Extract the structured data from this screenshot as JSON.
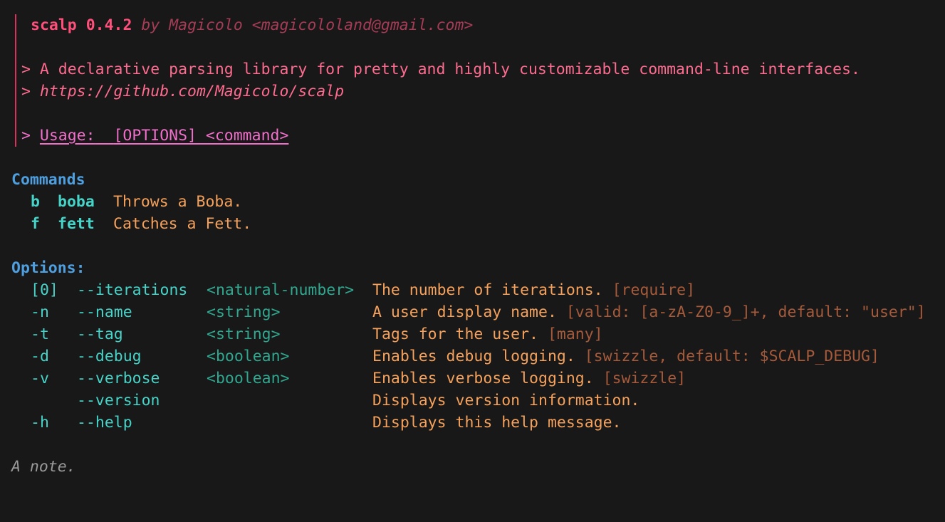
{
  "header": {
    "name": "scalp",
    "version": "0.4.2",
    "byline": "by Magicolo <magicololand@gmail.com>"
  },
  "description": {
    "prefix": ">",
    "summary": "A declarative parsing library for pretty and highly customizable command-line interfaces.",
    "url": "https://github.com/Magicolo/scalp"
  },
  "usage": {
    "prefix": ">",
    "label": "Usage:",
    "args": "[OPTIONS] <command>"
  },
  "commands": {
    "title": "Commands",
    "items": [
      {
        "short": "b",
        "name": "boba",
        "description": "Throws a Boba."
      },
      {
        "short": "f",
        "name": "fett",
        "description": "Catches a Fett."
      }
    ]
  },
  "options": {
    "title": "Options:",
    "items": [
      {
        "short": "[0]",
        "long": "--iterations",
        "type": "<natural-number>",
        "description": "The number of iterations.",
        "meta": "[require]"
      },
      {
        "short": "-n",
        "long": "--name",
        "type": "<string>",
        "description": "A user display name.",
        "meta": "[valid: [a-zA-Z0-9_]+, default: \"user\"]"
      },
      {
        "short": "-t",
        "long": "--tag",
        "type": "<string>",
        "description": "Tags for the user.",
        "meta": "[many]"
      },
      {
        "short": "-d",
        "long": "--debug",
        "type": "<boolean>",
        "description": "Enables debug logging.",
        "meta": "[swizzle, default: $SCALP_DEBUG]"
      },
      {
        "short": "-v",
        "long": "--verbose",
        "type": "<boolean>",
        "description": "Enables verbose logging.",
        "meta": "[swizzle]"
      },
      {
        "short": "",
        "long": "--version",
        "type": "",
        "description": "Displays version information.",
        "meta": ""
      },
      {
        "short": "-h",
        "long": "--help",
        "type": "",
        "description": "Displays this help message.",
        "meta": ""
      }
    ]
  },
  "note": "A note.",
  "colors": {
    "background": "#181818",
    "accent_bar": "#d6335d",
    "title": "#ff4f7a",
    "description": "#ff6b8f",
    "usage": "#ef6fc9",
    "section": "#4e9fe0",
    "flag": "#46d3c8",
    "type": "#2fa88f",
    "help_text": "#f5a15b",
    "meta": "#a65a3a",
    "note": "#9a9a9a"
  }
}
